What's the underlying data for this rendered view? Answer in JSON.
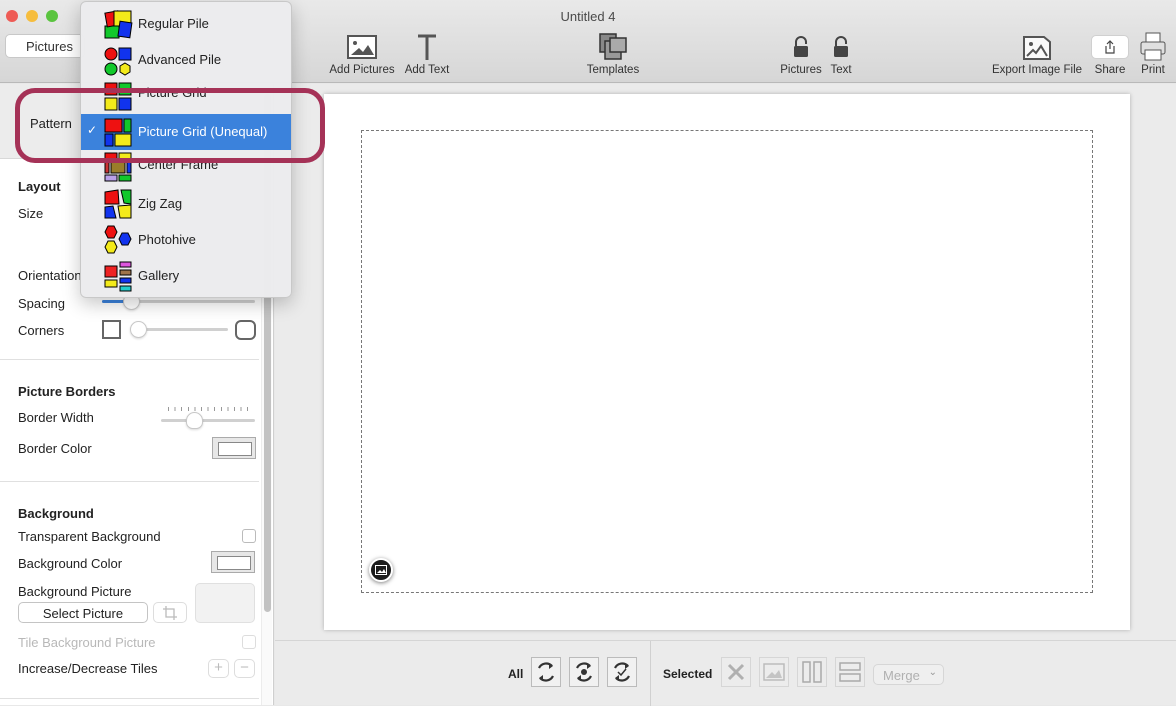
{
  "window": {
    "title": "Untitled 4",
    "traffic_colors": {
      "close": "#ee5b55",
      "minimize": "#f6bd3d",
      "zoom": "#5ac43f"
    }
  },
  "toolbar": {
    "segment_label": "Pictures",
    "items": [
      {
        "label": "Add Pictures",
        "icon": "image-icon"
      },
      {
        "label": "Add Text",
        "icon": "text-icon"
      },
      {
        "label": "Templates",
        "icon": "templates-icon"
      },
      {
        "label": "Pictures",
        "icon": "unlock-icon"
      },
      {
        "label": "Text",
        "icon": "unlock-icon"
      },
      {
        "label": "Export Image File",
        "icon": "export-image-icon"
      },
      {
        "label": "Share",
        "icon": "share-icon"
      },
      {
        "label": "Print",
        "icon": "printer-icon"
      }
    ]
  },
  "sidebar": {
    "pattern_label": "Pattern",
    "layout": {
      "header": "Layout",
      "size_label": "Size",
      "orientation_label": "Orientation",
      "spacing_label": "Spacing",
      "spacing_value": 0.14,
      "corners_label": "Corners",
      "corners_value": 0.0
    },
    "borders": {
      "header": "Picture Borders",
      "border_width_label": "Border Width",
      "border_width_value": 0.36,
      "border_color_label": "Border Color",
      "border_color": "#ffffff"
    },
    "background": {
      "header": "Background",
      "transparent_label": "Transparent Background",
      "transparent_checked": false,
      "color_label": "Background Color",
      "color": "#ffffff",
      "picture_label": "Background Picture",
      "select_picture_button": "Select Picture",
      "tile_label": "Tile Background Picture",
      "tile_checked": false,
      "tiles_label": "Increase/Decrease Tiles",
      "plus": "+",
      "minus": "−"
    }
  },
  "pattern_menu": {
    "selected": "Picture Grid (Unequal)",
    "items": [
      {
        "label": "Regular Pile"
      },
      {
        "label": "Advanced Pile"
      },
      {
        "label": "Picture Grid"
      },
      {
        "label": "Picture Grid (Unequal)",
        "checked": true
      },
      {
        "label": "Center Frame"
      },
      {
        "label": "Zig Zag"
      },
      {
        "label": "Photohive"
      },
      {
        "label": "Gallery"
      }
    ],
    "checkmark": "✓",
    "selection_color": "#3b82dc",
    "highlight_color": "#a53257"
  },
  "bottombar": {
    "all_label": "All",
    "selected_label": "Selected",
    "merge_label": "Merge"
  }
}
